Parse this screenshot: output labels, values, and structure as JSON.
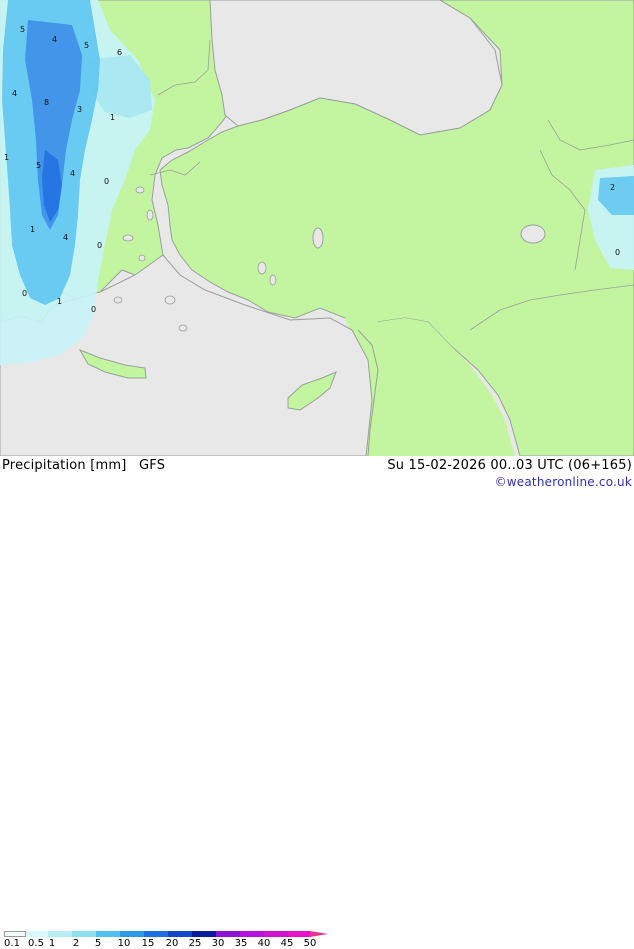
{
  "map": {
    "colors": {
      "sea": "#e8e8e8",
      "land": "#c3f5a0",
      "border": "#9aa09a",
      "precip_light": "#c8f4f8",
      "precip_medium": "#64c8f0",
      "precip_heavy": "#3c8ce6"
    },
    "contour_labels": [
      {
        "text": "5"
      },
      {
        "text": "4"
      },
      {
        "text": "5"
      },
      {
        "text": "6"
      },
      {
        "text": "4"
      },
      {
        "text": "8"
      },
      {
        "text": "3"
      },
      {
        "text": "1"
      },
      {
        "text": "1"
      },
      {
        "text": "5"
      },
      {
        "text": "4"
      },
      {
        "text": "0"
      },
      {
        "text": "1"
      },
      {
        "text": "4"
      },
      {
        "text": "0"
      },
      {
        "text": "0"
      },
      {
        "text": "1"
      },
      {
        "text": "0"
      },
      {
        "text": "0"
      },
      {
        "text": "2"
      },
      {
        "text": "0"
      }
    ]
  },
  "footer": {
    "title": "Precipitation [mm]",
    "model": "GFS",
    "datetime": "Su 15-02-2026 00..03 UTC (06+165)",
    "credit": "©weatheronline.co.uk"
  },
  "legend": {
    "ticks": [
      "0.1",
      "0.5",
      "1",
      "2",
      "5",
      "10",
      "15",
      "20",
      "25",
      "30",
      "35",
      "40",
      "45",
      "50"
    ],
    "colors": [
      "#f0fcfc",
      "#d8f8fa",
      "#b4eef4",
      "#8ce0f0",
      "#50c0ee",
      "#2c9ae6",
      "#1e6ee0",
      "#1446c8",
      "#0a1ea0",
      "#8c14d2",
      "#b414dc",
      "#d214d2",
      "#e614c8",
      "#f0328c"
    ]
  }
}
